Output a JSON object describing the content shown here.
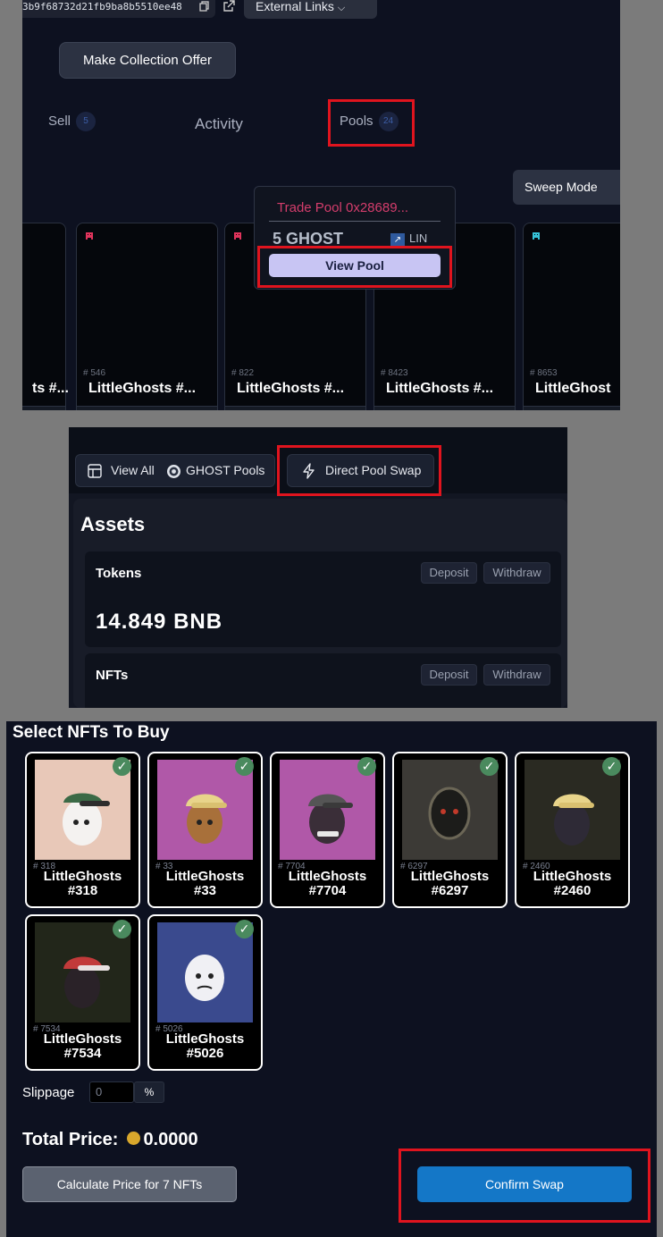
{
  "top": {
    "address": "3b9f68732d21fb9ba8b5510ee48",
    "external_links": "External Links",
    "make_offer": "Make Collection Offer",
    "tabs": [
      {
        "label": "Sell",
        "count": "5"
      },
      {
        "label": "Activity",
        "count": ""
      },
      {
        "label": "Pools",
        "count": "24"
      }
    ],
    "sweep_mode": "Sweep Mode",
    "cards": [
      {
        "num": "",
        "name": "ts #..."
      },
      {
        "num": "# 546",
        "name": "LittleGhosts #..."
      },
      {
        "num": "# 822",
        "name": "LittleGhosts #..."
      },
      {
        "num": "# 8423",
        "name": "LittleGhosts #..."
      },
      {
        "num": "# 8653",
        "name": "LittleGhost"
      }
    ],
    "tooltip": {
      "title": "Trade Pool 0x28689...",
      "amount": "5 GHOST",
      "lin": "LIN",
      "view_pool": "View Pool"
    }
  },
  "middle": {
    "view_all": "View All",
    "ghost_pools": "GHOST Pools",
    "direct_pool_swap": "Direct Pool Swap",
    "assets_title": "Assets",
    "tokens_label": "Tokens",
    "nfts_label": "NFTs",
    "deposit": "Deposit",
    "withdraw": "Withdraw",
    "balance": "14.849 BNB"
  },
  "bottom": {
    "title": "Select NFTs To Buy",
    "nfts": [
      {
        "num": "# 318",
        "name": "LittleGhosts",
        "id": "#318"
      },
      {
        "num": "# 33",
        "name": "LittleGhosts",
        "id": "#33"
      },
      {
        "num": "# 7704",
        "name": "LittleGhosts",
        "id": "#7704"
      },
      {
        "num": "# 6297",
        "name": "LittleGhosts",
        "id": "#6297"
      },
      {
        "num": "# 2460",
        "name": "LittleGhosts",
        "id": "#2460"
      },
      {
        "num": "# 7534",
        "name": "LittleGhosts",
        "id": "#7534"
      },
      {
        "num": "# 5026",
        "name": "LittleGhosts",
        "id": "#5026"
      }
    ],
    "slippage_label": "Slippage",
    "slippage_value": "0",
    "slippage_unit": "%",
    "total_label": "Total Price:",
    "total_value": "0.0000",
    "calculate": "Calculate Price for 7 NFTs",
    "confirm": "Confirm Swap"
  },
  "colors": {
    "accent": "#1477c7",
    "highlight": "#e0141e",
    "check": "#4a8a5e",
    "pool_title": "#d43d6c"
  }
}
